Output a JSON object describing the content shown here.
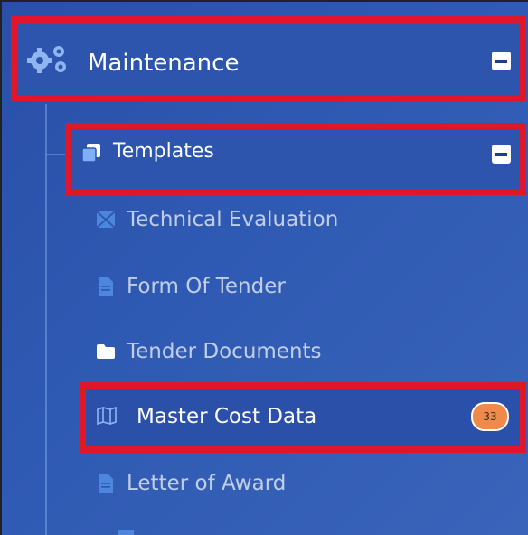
{
  "menu": {
    "maintenance": {
      "label": "Maintenance",
      "icon": "gears-icon",
      "toggle": "collapse"
    },
    "templates": {
      "label": "Templates",
      "icon": "copy-icon",
      "toggle": "collapse"
    },
    "items": [
      {
        "label": "Technical Evaluation",
        "icon": "evaluation-icon"
      },
      {
        "label": "Form Of Tender",
        "icon": "document-icon"
      },
      {
        "label": "Tender Documents",
        "icon": "folder-icon"
      },
      {
        "label": "Master Cost Data",
        "icon": "map-icon",
        "badge": "33"
      },
      {
        "label": "Letter of Award",
        "icon": "document-icon"
      }
    ]
  },
  "colors": {
    "sidebar_bg": "#2f5ab3",
    "highlight_border": "#e0162b",
    "badge_bg": "#f08a4b"
  }
}
